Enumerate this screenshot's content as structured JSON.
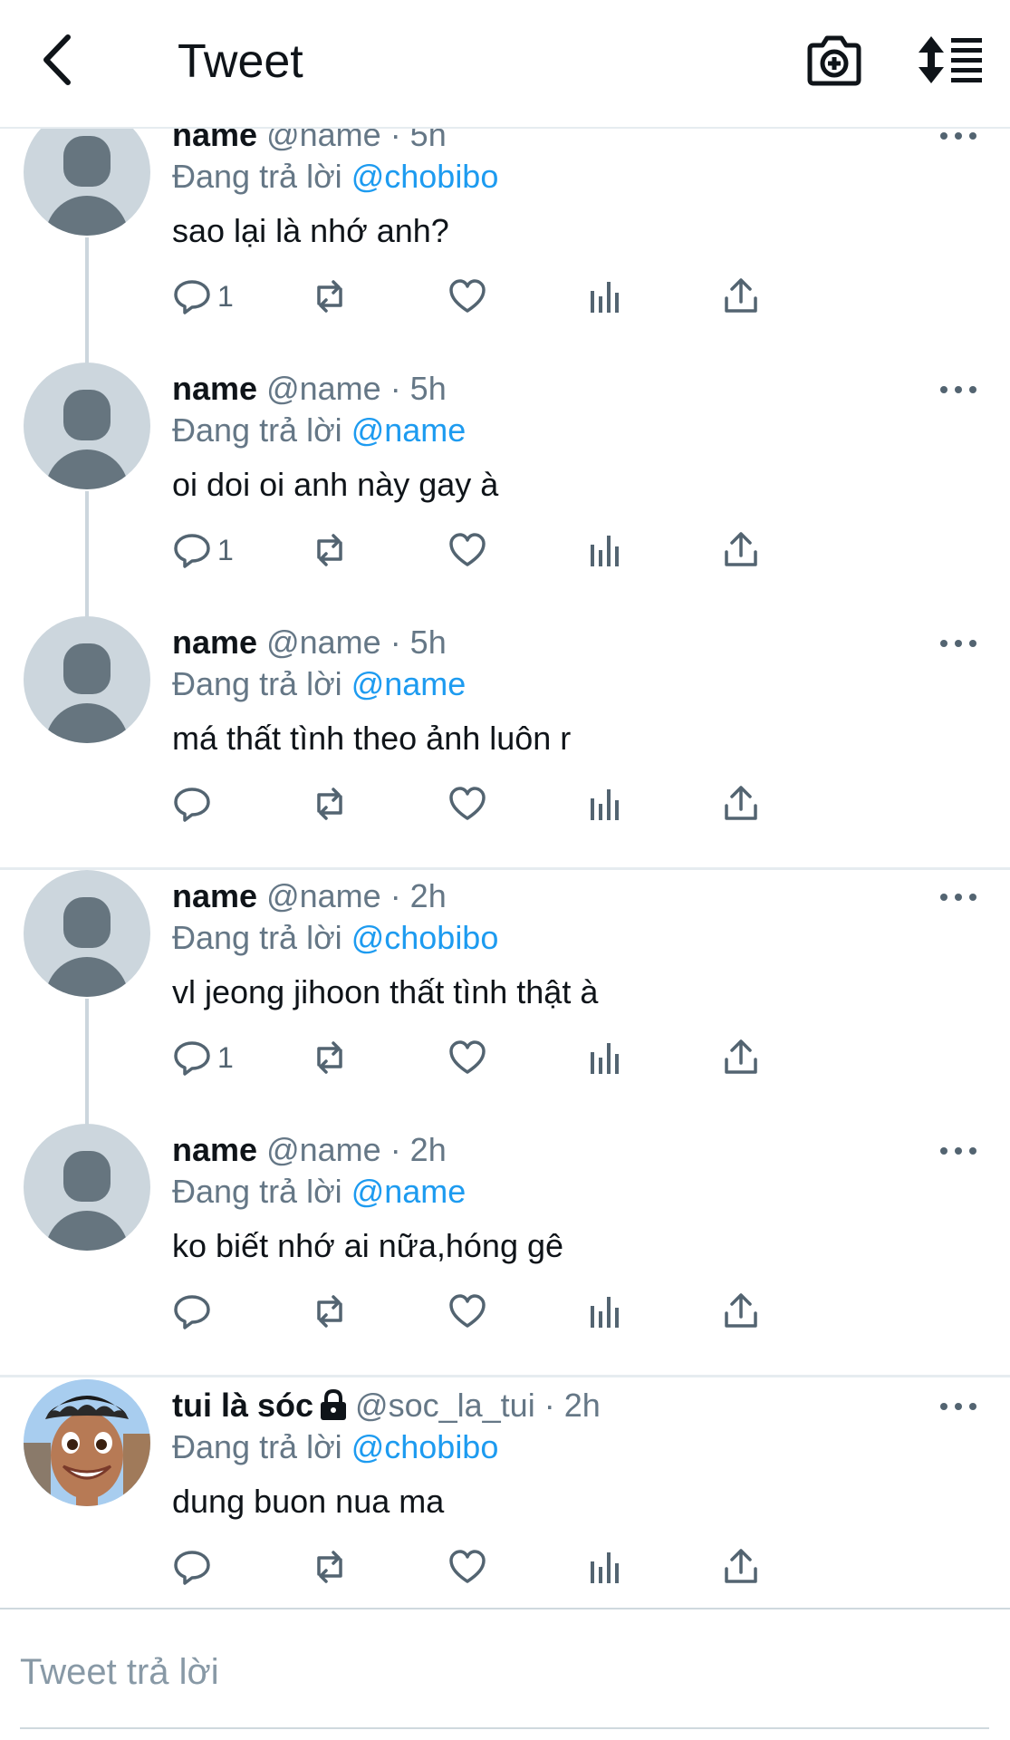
{
  "header": {
    "title": "Tweet"
  },
  "tweets": [
    {
      "name": "name",
      "handle": "@name",
      "time": "· 5h",
      "reply_prefix": "Đang trả lời",
      "reply_to": "@chobibo",
      "text": "sao lại là nhớ anh?",
      "reply_count": "1"
    },
    {
      "name": "name",
      "handle": "@name",
      "time": "· 5h",
      "reply_prefix": "Đang trả lời",
      "reply_to": "@name",
      "text": "oi doi oi anh này gay à",
      "reply_count": "1"
    },
    {
      "name": "name",
      "handle": "@name",
      "time": "· 5h",
      "reply_prefix": "Đang trả lời",
      "reply_to": "@name",
      "text": "má thất tình theo ảnh luôn r",
      "reply_count": ""
    },
    {
      "name": "name",
      "handle": "@name",
      "time": "· 2h",
      "reply_prefix": "Đang trả lời",
      "reply_to": "@chobibo",
      "text": "vl jeong jihoon thất tình thật à",
      "reply_count": "1"
    },
    {
      "name": "name",
      "handle": "@name",
      "time": "· 2h",
      "reply_prefix": "Đang trả lời",
      "reply_to": "@name",
      "text": "ko biết nhớ ai nữa,hóng gê",
      "reply_count": ""
    },
    {
      "name": "tui là sóc",
      "handle": "@soc_la_tui",
      "time": "· 2h",
      "reply_prefix": "Đang trả lời",
      "reply_to": "@chobibo",
      "text": "dung buon nua ma",
      "reply_count": ""
    }
  ],
  "composer": {
    "placeholder": "Tweet trả lời"
  },
  "icons": {
    "back": "chevron-left-icon",
    "camera": "camera-plus-icon",
    "sort": "sort-icon",
    "reply": "reply-icon",
    "retweet": "retweet-icon",
    "like": "heart-icon",
    "views": "bar-chart-icon",
    "share": "share-icon",
    "more": "more-dots-icon",
    "lock": "lock-icon"
  },
  "colors": {
    "mention": "#1d9bf0",
    "muted": "#657786",
    "avatar_bg": "#ccd6dd",
    "avatar_fg": "#66757f"
  }
}
